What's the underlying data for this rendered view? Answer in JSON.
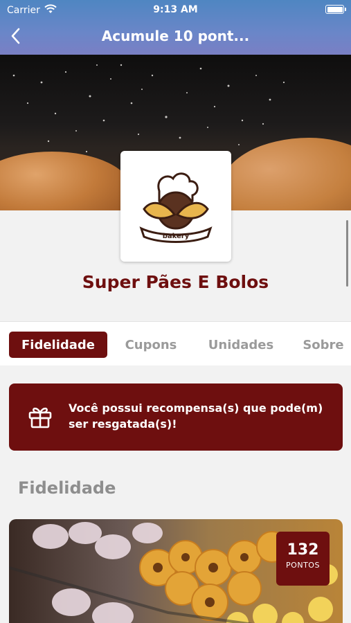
{
  "status_bar": {
    "carrier": "Carrier",
    "time": "9:13 AM"
  },
  "nav": {
    "title": "Acumule 10 pont...",
    "back_icon": "chevron-left-icon"
  },
  "store": {
    "name": "Super Pães E Bolos",
    "logo_text": "bakery"
  },
  "tabs": [
    {
      "label": "Fidelidade",
      "active": true
    },
    {
      "label": "Cupons",
      "active": false
    },
    {
      "label": "Unidades",
      "active": false
    },
    {
      "label": "Sobre",
      "active": false
    }
  ],
  "reward_banner": {
    "icon": "gift-icon",
    "message": "Você possui recompensa(s) que pode(m) ser resgatada(s)!"
  },
  "section": {
    "title": "Fidelidade"
  },
  "loyalty_card": {
    "points": "132",
    "points_label": "PONTOS"
  },
  "colors": {
    "brand": "#6e0f0f",
    "header": "#6a86c8",
    "muted_text": "#9a9a9a"
  }
}
